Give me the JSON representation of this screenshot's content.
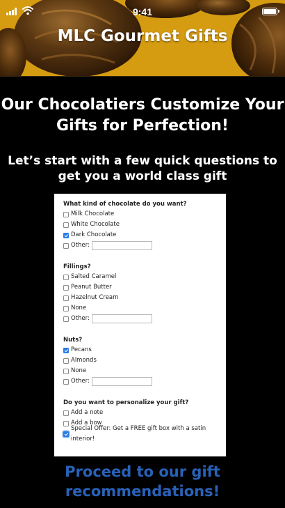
{
  "status_bar": {
    "time": "9:41"
  },
  "header": {
    "app_title": "MLC Gourmet Gifts",
    "background_icon": "chocolate-truffles-image"
  },
  "colors": {
    "header_gold": "#d59b11",
    "background": "#000000",
    "cta_blue": "#2862b8",
    "checkbox_blue": "#2a7be4"
  },
  "main": {
    "headline": "Our Chocolatiers Customize Your Gifts for Perfection!",
    "subhead": "Let’s start with a few quick questions to get you a world class gift"
  },
  "form": {
    "q1": {
      "title": "What kind of chocolate do you want?",
      "options": [
        {
          "label": "Milk Chocolate",
          "checked": false
        },
        {
          "label": "White Chocolate",
          "checked": false
        },
        {
          "label": "Dark Chocolate",
          "checked": true
        },
        {
          "label": "Other:",
          "checked": false
        }
      ],
      "other_value": ""
    },
    "q2": {
      "title": "Fillings?",
      "options": [
        {
          "label": "Salted Caramel",
          "checked": false
        },
        {
          "label": "Peanut Butter",
          "checked": false
        },
        {
          "label": "Hazelnut Cream",
          "checked": false
        },
        {
          "label": "None",
          "checked": false
        },
        {
          "label": "Other:",
          "checked": false
        }
      ],
      "other_value": ""
    },
    "q3": {
      "title": "Nuts?",
      "options": [
        {
          "label": "Pecans",
          "checked": true
        },
        {
          "label": "Almonds",
          "checked": false
        },
        {
          "label": "None",
          "checked": false
        },
        {
          "label": "Other:",
          "checked": false
        }
      ],
      "other_value": ""
    },
    "q4": {
      "title": "Do you want to personalize your gift?",
      "options": [
        {
          "label": "Add a note",
          "checked": false
        },
        {
          "label": "Add a bow",
          "checked": false
        },
        {
          "label": "Special Offer: Get a FREE gift box with a satin interior!",
          "checked": true
        }
      ]
    }
  },
  "cta": {
    "label": "Proceed to our gift recommendations!"
  }
}
